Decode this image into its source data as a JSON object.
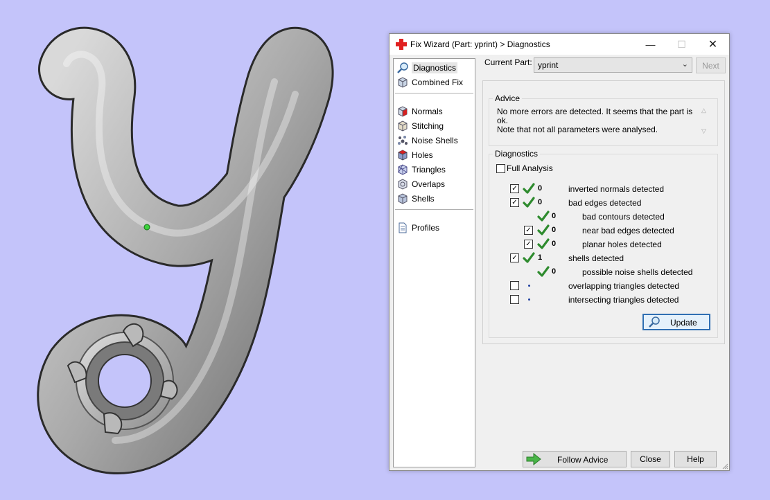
{
  "window": {
    "title": "Fix Wizard (Part: yprint) > Diagnostics",
    "icon": "red-cross-icon",
    "minimize_glyph": "—",
    "maximize_glyph": "☐",
    "close_glyph": "✕"
  },
  "nav": {
    "items": [
      {
        "label": "Diagnostics",
        "icon": "magnifier-icon",
        "selected": true
      },
      {
        "label": "Combined Fix",
        "icon": "cube-icon"
      },
      {
        "label": "Normals",
        "icon": "normals-cube-icon"
      },
      {
        "label": "Stitching",
        "icon": "stitching-cube-icon"
      },
      {
        "label": "Noise Shells",
        "icon": "noise-shells-icon"
      },
      {
        "label": "Holes",
        "icon": "holes-cube-icon"
      },
      {
        "label": "Triangles",
        "icon": "triangles-cube-icon"
      },
      {
        "label": "Overlaps",
        "icon": "overlaps-icon"
      },
      {
        "label": "Shells",
        "icon": "shells-cube-icon"
      },
      {
        "label": "Profiles",
        "icon": "document-icon"
      }
    ]
  },
  "current_part": {
    "label": "Current Part:",
    "value": "yprint",
    "next_label": "Next"
  },
  "advice": {
    "legend": "Advice",
    "text": "No more errors are detected. It seems that the part is ok.\nNote that not all parameters were analysed."
  },
  "diagnostics": {
    "legend": "Diagnostics",
    "full_analysis_label": "Full Analysis",
    "full_analysis_checked": false,
    "rows": [
      {
        "checkbox": true,
        "checked": true,
        "status": "ok",
        "count": "0",
        "label": "inverted normals detected"
      },
      {
        "checkbox": true,
        "checked": true,
        "status": "ok",
        "count": "0",
        "label": "bad edges detected"
      },
      {
        "checkbox": false,
        "status": "ok",
        "count": "0",
        "label": "bad contours detected"
      },
      {
        "checkbox": true,
        "checked": true,
        "status": "ok",
        "count": "0",
        "label": "near bad edges detected"
      },
      {
        "checkbox": true,
        "checked": true,
        "status": "ok",
        "count": "0",
        "label": "planar holes detected"
      },
      {
        "checkbox": true,
        "checked": true,
        "status": "ok",
        "count": "1",
        "label": "shells detected"
      },
      {
        "checkbox": false,
        "status": "ok",
        "count": "0",
        "label": "possible noise shells detected"
      },
      {
        "checkbox": true,
        "checked": false,
        "status": "not-run",
        "count": "",
        "label": "overlapping triangles detected"
      },
      {
        "checkbox": true,
        "checked": false,
        "status": "not-run",
        "count": "",
        "label": "intersecting triangles detected"
      }
    ],
    "update_label": "Update"
  },
  "buttons": {
    "follow_advice": "Follow Advice",
    "close": "Close",
    "help": "Help"
  },
  "colors": {
    "background": "#c4c4fa",
    "check_green": "#2e8b2e",
    "focus_blue": "#2f6fb3"
  }
}
